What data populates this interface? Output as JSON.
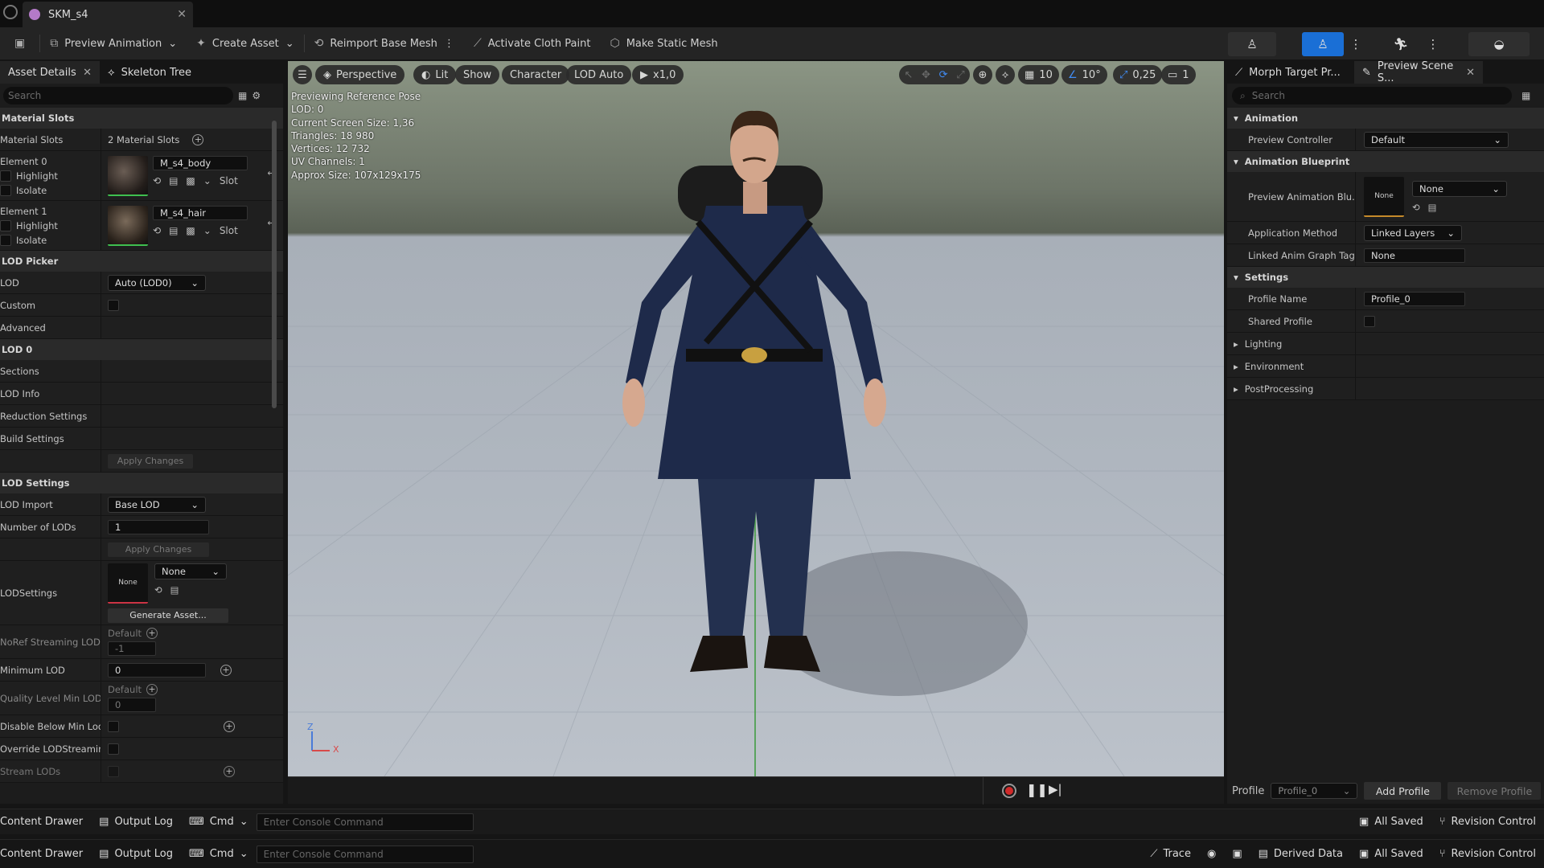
{
  "window": {
    "tab_title": "SKM_s4",
    "close_glyph": "✕"
  },
  "toolbar": {
    "preview_animation": "Preview Animation",
    "create_asset": "Create Asset",
    "reimport": "Reimport Base Mesh",
    "cloth_paint": "Activate Cloth Paint",
    "static_mesh": "Make Static Mesh"
  },
  "left": {
    "tabs": [
      "Asset Details",
      "Skeleton Tree"
    ],
    "search_placeholder": "Search",
    "material_slots_header": "Material Slots",
    "material_slots_label": "Material Slots",
    "material_slots_count": "2 Material Slots",
    "element0": {
      "label": "Element 0",
      "material": "M_s4_body",
      "highlight": "Highlight",
      "isolate": "Isolate",
      "slot": "Slot"
    },
    "element1": {
      "label": "Element 1",
      "material": "M_s4_hair",
      "highlight": "Highlight",
      "isolate": "Isolate",
      "slot": "Slot"
    },
    "lod_picker_header": "LOD Picker",
    "lod_label": "LOD",
    "lod_value": "Auto (LOD0)",
    "custom_label": "Custom",
    "advanced_label": "Advanced",
    "lod0_header": "LOD 0",
    "sections_label": "Sections",
    "lod_info_label": "LOD Info",
    "reduction_label": "Reduction Settings",
    "build_label": "Build Settings",
    "apply_changes": "Apply Changes",
    "lod_settings_header": "LOD Settings",
    "lod_import_label": "LOD Import",
    "lod_import_value": "Base LOD",
    "num_lods_label": "Number of LODs",
    "num_lods_value": "1",
    "apply_changes2": "Apply Changes",
    "lodsettings_label": "LODSettings",
    "lodsettings_thumb": "None",
    "lodsettings_combo": "None",
    "generate_asset": "Generate Asset...",
    "noref_label": "NoRef Streaming LOD B",
    "noref_default": "Default",
    "noref_value": "-1",
    "min_lod_label": "Minimum LOD",
    "min_lod_value": "0",
    "quality_label": "Quality Level Min LOD",
    "quality_default": "Default",
    "quality_value": "0",
    "disable_below_label": "Disable Below Min Lod...",
    "override_label": "Override LODStreamin...",
    "stream_lods_label": "Stream LODs"
  },
  "viewport": {
    "perspective": "Perspective",
    "lit": "Lit",
    "show": "Show",
    "character": "Character",
    "lod": "LOD Auto",
    "speed": "x1,0",
    "grid": "10",
    "angle": "10°",
    "scale": "0,25",
    "camera": "1",
    "stats": [
      "Previewing Reference Pose",
      "LOD: 0",
      "Current Screen Size: 1,36",
      "Triangles: 18 980",
      "Vertices: 12 732",
      "UV Channels: 1",
      "Approx Size: 107x129x175"
    ],
    "axis_z": "Z",
    "axis_x": "X"
  },
  "right": {
    "tabs": [
      "Morph Target Pr...",
      "Preview Scene S..."
    ],
    "search_placeholder": "Search",
    "animation_header": "Animation",
    "preview_controller_label": "Preview Controller",
    "preview_controller_value": "Default",
    "anim_bp_header": "Animation Blueprint",
    "preview_anim_bp_label": "Preview Animation Blu...",
    "preview_anim_thumb": "None",
    "preview_anim_combo": "None",
    "app_method_label": "Application Method",
    "app_method_value": "Linked Layers",
    "linked_tag_label": "Linked Anim Graph Tag",
    "linked_tag_value": "None",
    "settings_header": "Settings",
    "profile_name_label": "Profile Name",
    "profile_name_value": "Profile_0",
    "shared_profile_label": "Shared Profile",
    "lighting": "Lighting",
    "environment": "Environment",
    "postprocessing": "PostProcessing",
    "profile_label": "Profile",
    "profile_select": "Profile_0",
    "add_profile": "Add Profile",
    "remove_profile": "Remove Profile"
  },
  "statusbar": {
    "content_drawer": "Content Drawer",
    "output_log": "Output Log",
    "cmd": "Cmd",
    "console_placeholder": "Enter Console Command",
    "trace": "Trace",
    "derived_data": "Derived Data",
    "all_saved": "All Saved",
    "revision_control": "Revision Control"
  }
}
